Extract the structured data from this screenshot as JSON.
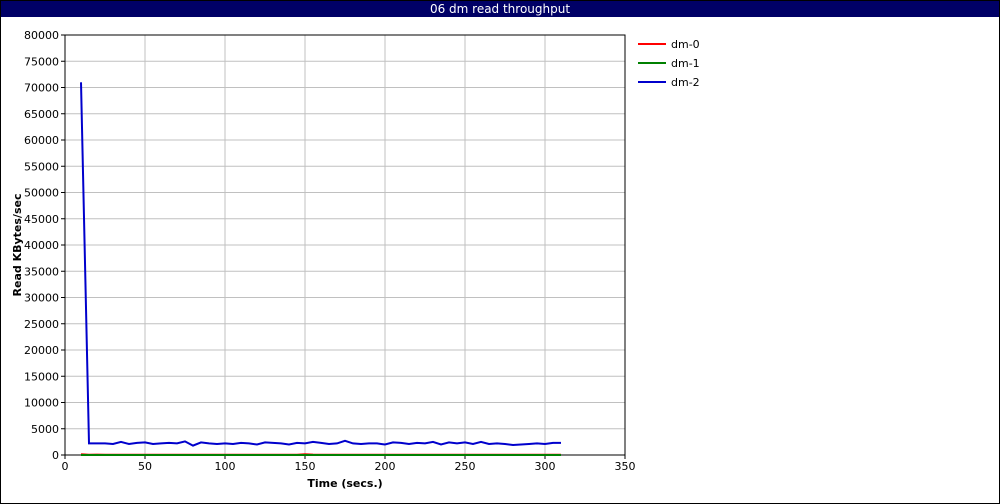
{
  "chart_data": {
    "type": "line",
    "title": "06 dm read throughput",
    "xlabel": "Time (secs.)",
    "ylabel": "Read KBytes/sec",
    "xlim": [
      0,
      350
    ],
    "ylim": [
      0,
      80000
    ],
    "xticks": [
      0,
      50,
      100,
      150,
      200,
      250,
      300,
      350
    ],
    "yticks": [
      0,
      5000,
      10000,
      15000,
      20000,
      25000,
      30000,
      35000,
      40000,
      45000,
      50000,
      55000,
      60000,
      65000,
      70000,
      75000,
      80000
    ],
    "grid": true,
    "legend_position": "right",
    "x": [
      10,
      15,
      20,
      25,
      30,
      35,
      40,
      45,
      50,
      55,
      60,
      65,
      70,
      75,
      80,
      85,
      90,
      95,
      100,
      105,
      110,
      115,
      120,
      125,
      130,
      135,
      140,
      145,
      150,
      155,
      160,
      165,
      170,
      175,
      180,
      185,
      190,
      195,
      200,
      205,
      210,
      215,
      220,
      225,
      230,
      235,
      240,
      245,
      250,
      255,
      260,
      265,
      270,
      275,
      280,
      285,
      290,
      295,
      300,
      305,
      310
    ],
    "series": [
      {
        "name": "dm-0",
        "color": "#ff0000",
        "values": [
          150,
          50,
          80,
          60,
          50,
          40,
          60,
          50,
          40,
          50,
          60,
          40,
          50,
          40,
          60,
          50,
          40,
          50,
          40,
          60,
          50,
          40,
          50,
          60,
          40,
          50,
          60,
          50,
          150,
          80,
          50,
          40,
          60,
          50,
          40,
          50,
          60,
          40,
          50,
          40,
          60,
          50,
          40,
          50,
          60,
          40,
          50,
          60,
          40,
          50,
          60,
          40,
          50,
          40,
          60,
          50,
          40,
          50,
          60,
          40,
          50
        ]
      },
      {
        "name": "dm-1",
        "color": "#008000",
        "values": [
          0,
          0,
          0,
          0,
          0,
          0,
          0,
          0,
          0,
          0,
          0,
          0,
          0,
          0,
          0,
          0,
          0,
          0,
          0,
          0,
          0,
          0,
          0,
          0,
          0,
          0,
          0,
          0,
          0,
          0,
          0,
          0,
          0,
          0,
          0,
          0,
          0,
          0,
          0,
          0,
          0,
          0,
          0,
          0,
          0,
          0,
          0,
          0,
          0,
          0,
          0,
          0,
          0,
          0,
          0,
          0,
          0,
          0,
          0,
          0,
          0
        ]
      },
      {
        "name": "dm-2",
        "color": "#0000cc",
        "values": [
          71000,
          2200,
          2200,
          2200,
          2100,
          2500,
          2100,
          2300,
          2400,
          2100,
          2200,
          2300,
          2200,
          2600,
          1800,
          2400,
          2200,
          2100,
          2200,
          2100,
          2300,
          2200,
          2000,
          2400,
          2300,
          2200,
          2000,
          2300,
          2200,
          2500,
          2300,
          2100,
          2200,
          2700,
          2200,
          2100,
          2200,
          2200,
          2000,
          2400,
          2300,
          2100,
          2300,
          2200,
          2500,
          2000,
          2400,
          2200,
          2400,
          2100,
          2500,
          2100,
          2200,
          2100,
          1900,
          2000,
          2100,
          2200,
          2100,
          2300,
          2300
        ]
      }
    ]
  }
}
